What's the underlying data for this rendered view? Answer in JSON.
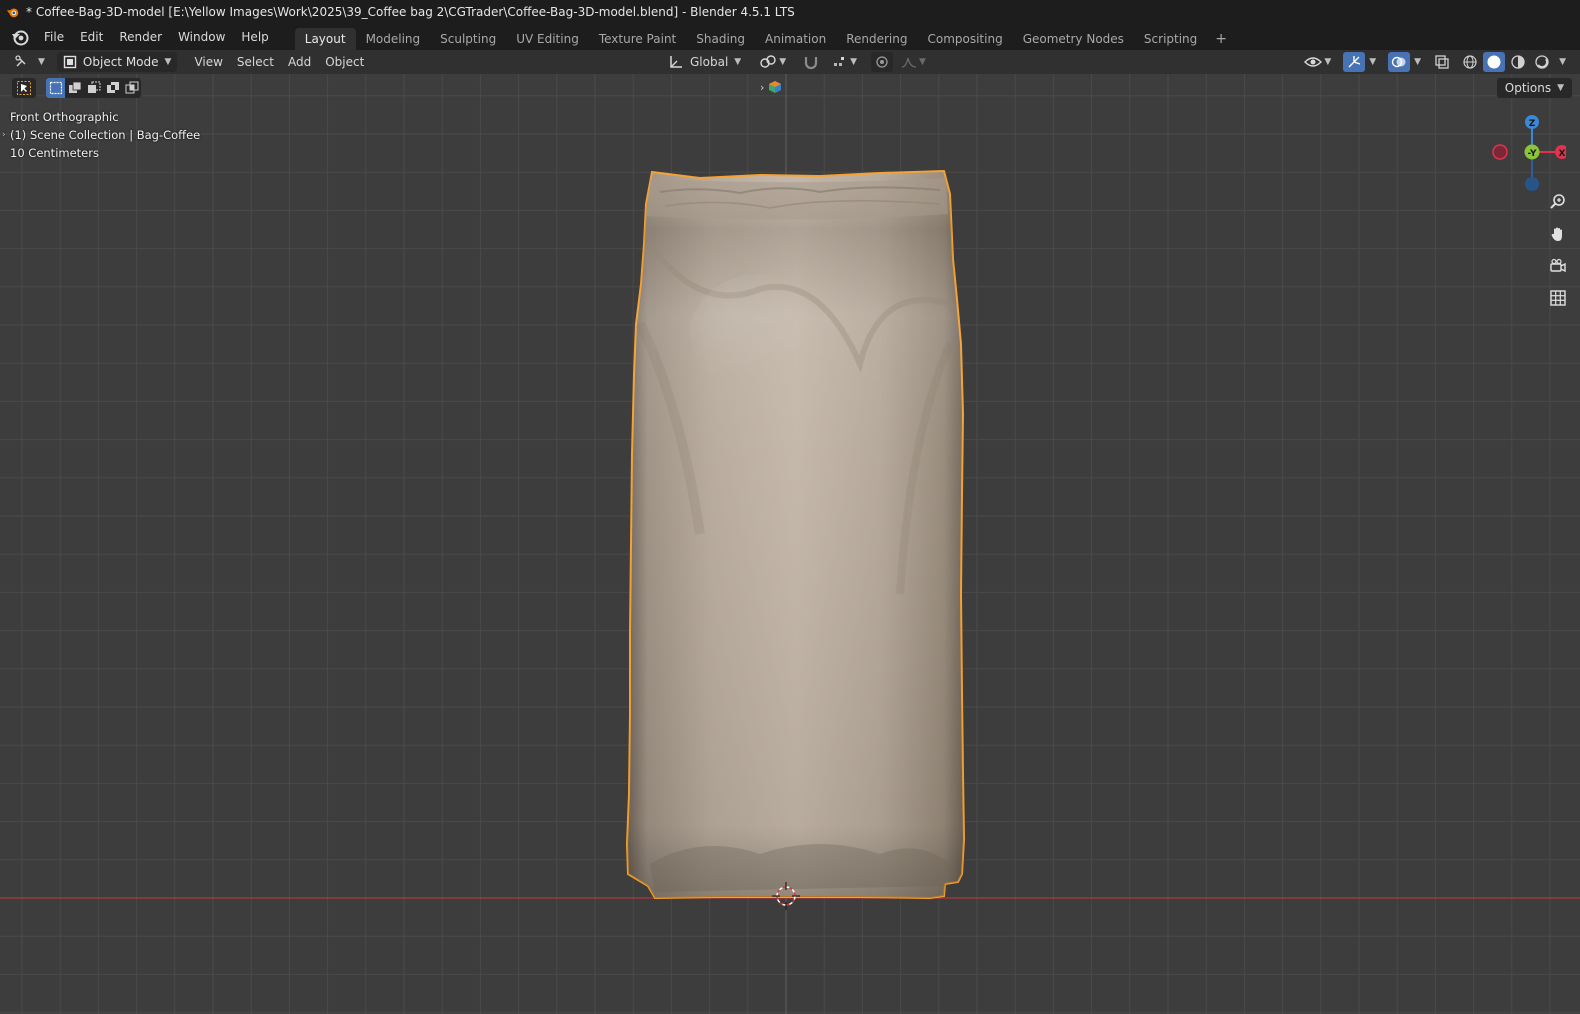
{
  "window": {
    "title": "* Coffee-Bag-3D-model [E:\\Yellow Images\\Work\\2025\\39_Coffee bag 2\\CGTrader\\Coffee-Bag-3D-model.blend] - Blender 4.5.1 LTS"
  },
  "menu": {
    "items": [
      "File",
      "Edit",
      "Render",
      "Window",
      "Help"
    ]
  },
  "workspaces": {
    "tabs": [
      "Layout",
      "Modeling",
      "Sculpting",
      "UV Editing",
      "Texture Paint",
      "Shading",
      "Animation",
      "Rendering",
      "Compositing",
      "Geometry Nodes",
      "Scripting"
    ],
    "active": "Layout",
    "add_label": "+"
  },
  "header": {
    "mode": "Object Mode",
    "menus": [
      "View",
      "Select",
      "Add",
      "Object"
    ],
    "transform_orientation": "Global",
    "options_label": "Options"
  },
  "viewport": {
    "view_name": "Front Orthographic",
    "collection_line": "(1) Scene Collection | Bag-Coffee",
    "grid_scale": "10 Centimeters",
    "object_name": "Bag-Coffee",
    "selection_color": "#f5a030",
    "background_color": "#3d3d3d",
    "grid_color": "#4a4a4a",
    "x_axis_color": "#b03a3a"
  },
  "gizmo": {
    "axes": [
      "Z",
      "Y",
      "X"
    ],
    "x_color": "#e0334d",
    "y_color": "#8ac53a",
    "z_color": "#3b87d8"
  },
  "nav_tools": [
    "zoom-icon",
    "pan-hand-icon",
    "camera-icon",
    "ortho-grid-icon"
  ],
  "colors": {
    "active_blue": "#4772b3",
    "bag_base": "#b8aa9c"
  }
}
